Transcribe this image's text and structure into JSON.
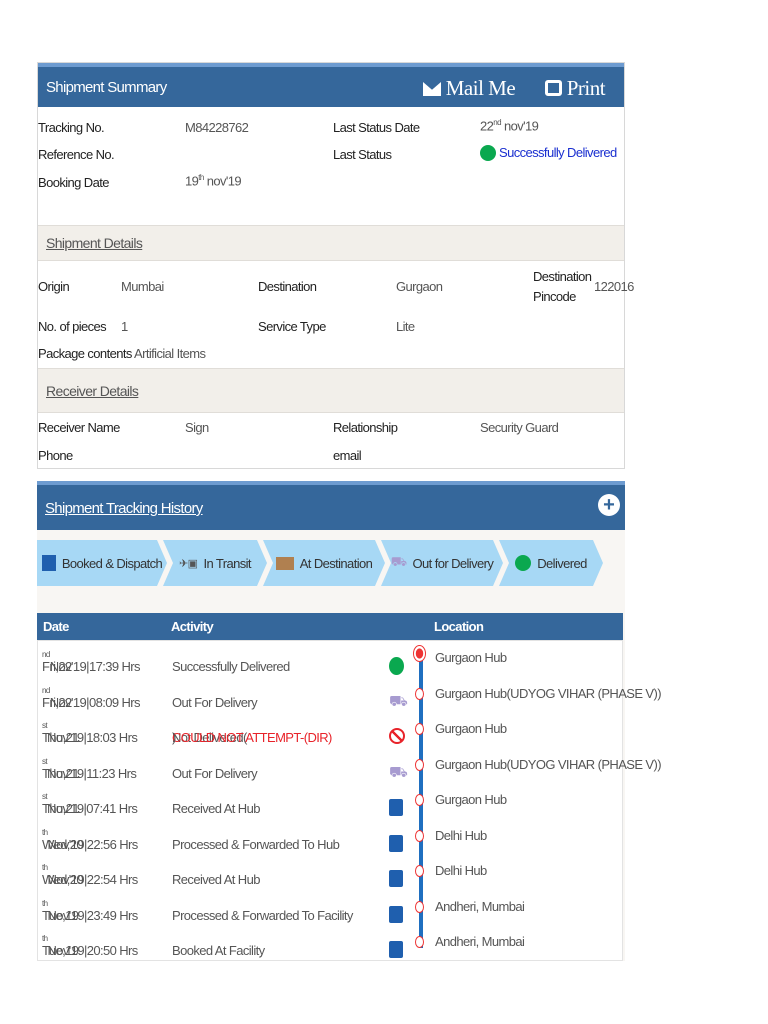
{
  "summary": {
    "title": "Shipment Summary",
    "mail_label": "Mail Me",
    "print_label": "Print",
    "tracking_label": "Tracking No.",
    "tracking_value": "M84228762",
    "reference_label": "Reference No.",
    "booking_label": "Booking Date",
    "booking_day": "19",
    "booking_sup": "th",
    "booking_rest": " nov'19",
    "last_date_label": "Last Status Date",
    "last_date_day": "22",
    "last_date_sup": "nd",
    "last_date_rest": " nov'19",
    "last_status_label": "Last Status",
    "last_status_value": "Successfully Delivered"
  },
  "details": {
    "title": "Shipment Details",
    "origin_label": "Origin",
    "origin": "Mumbai",
    "destination_label": "Destination",
    "destination": "Gurgaon",
    "pincode_label": "Destination Pincode",
    "pincode": "122016",
    "pieces_label": "No. of pieces",
    "pieces": "1",
    "service_label": "Service Type",
    "service": "Lite",
    "contents_label": "Package contents",
    "contents": "Artificial Items"
  },
  "receiver": {
    "title": "Receiver Details",
    "name_label": "Receiver Name",
    "name": "Sign",
    "relationship_label": "Relationship",
    "relationship": "Security Guard",
    "phone_label": "Phone",
    "email_label": "email"
  },
  "history": {
    "title": "Shipment Tracking History",
    "steps": [
      "Booked & Dispatch",
      "In Transit",
      "At Destination",
      "Out for Delivery",
      "Delivered"
    ],
    "columns": [
      "Date",
      "Activity",
      "Location"
    ],
    "rows": [
      {
        "day": "Fri,22",
        "sup": "nd",
        "rest": " Nov'19|17:39 Hrs",
        "activity": "Successfully Delivered",
        "extra": "",
        "icon": "delivered",
        "location": "Gurgaon Hub"
      },
      {
        "day": "Fri,22",
        "sup": "nd",
        "rest": " Nov'19|08:09 Hrs",
        "activity": "Out For Delivery",
        "extra": "",
        "icon": "out-for-delivery",
        "location": "Gurgaon Hub(UDYOG VIHAR (PHASE V))"
      },
      {
        "day": "Thu,21",
        "sup": "st",
        "rest": " Nov'19|18:03 Hrs",
        "activity": "Not Delivered(",
        "extra": "COULD NOT ATTEMPT-(DIR)",
        "extra_close": ")",
        "icon": "not-delivered",
        "location": "Gurgaon Hub"
      },
      {
        "day": "Thu,21",
        "sup": "st",
        "rest": " Nov'19|11:23 Hrs",
        "activity": "Out For Delivery",
        "extra": "",
        "icon": "out-for-delivery",
        "location": "Gurgaon Hub(UDYOG VIHAR (PHASE V))"
      },
      {
        "day": "Thu,21",
        "sup": "st",
        "rest": " Nov'19|07:41 Hrs",
        "activity": "Received At Hub",
        "extra": "",
        "icon": "package",
        "location": "Gurgaon Hub"
      },
      {
        "day": "Wed,20",
        "sup": "th",
        "rest": " Nov'19|22:56 Hrs",
        "activity": "Processed & Forwarded To Hub",
        "extra": "",
        "icon": "package",
        "location": "Delhi Hub"
      },
      {
        "day": "Wed,20",
        "sup": "th",
        "rest": " Nov'19|22:54 Hrs",
        "activity": "Received At Hub",
        "extra": "",
        "icon": "package",
        "location": "Delhi Hub"
      },
      {
        "day": "Tue,19",
        "sup": "th",
        "rest": " Nov'19|23:49 Hrs",
        "activity": "Processed & Forwarded To Facility",
        "extra": "",
        "icon": "package",
        "location": "Andheri, Mumbai"
      },
      {
        "day": "Tue,19",
        "sup": "th",
        "rest": " Nov'19|20:50 Hrs",
        "activity": "Booked At Facility",
        "extra": "",
        "icon": "package",
        "location": "Andheri, Mumbai"
      }
    ]
  },
  "colors": {
    "header": "#35679b",
    "delivered": "#0aa84f",
    "status_text": "#1a2fd0",
    "error": "#e8232a",
    "step": "#a7d8f5"
  }
}
